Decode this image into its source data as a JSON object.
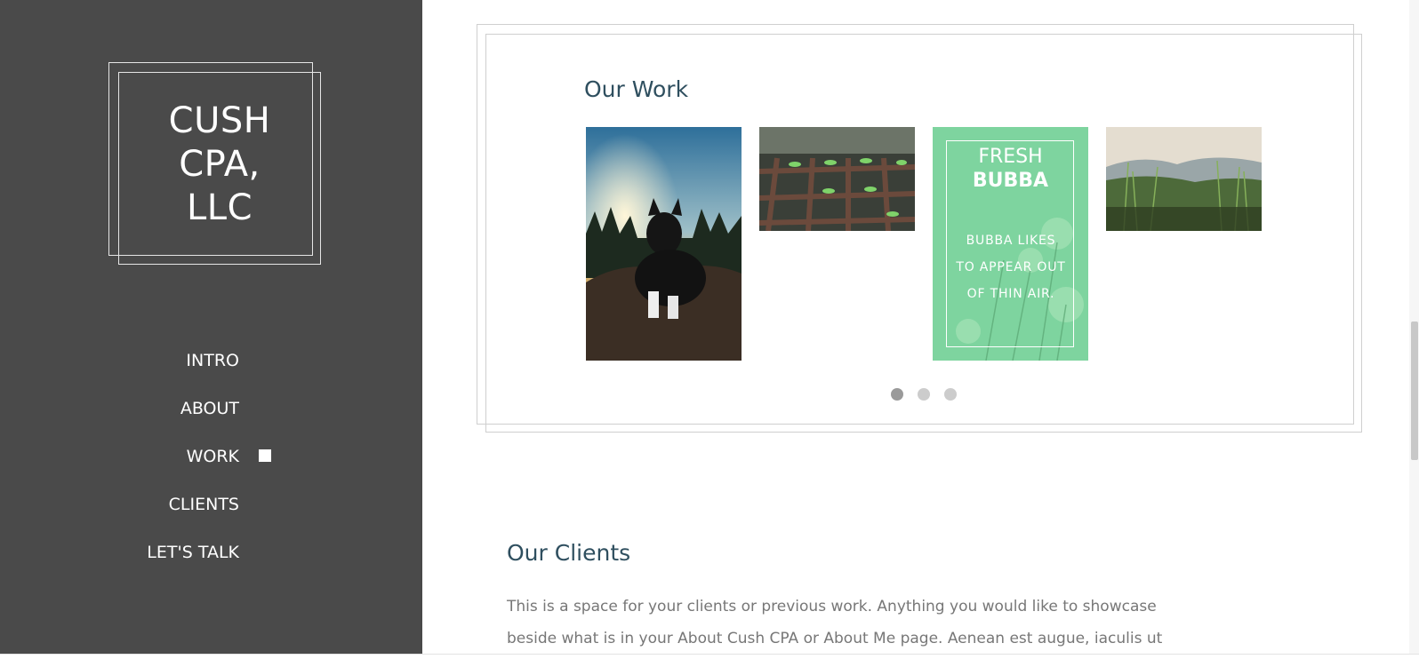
{
  "sidebar": {
    "logo": {
      "line1": "CUSH",
      "line2": "CPA,",
      "line3": "LLC"
    },
    "nav": [
      {
        "label": "INTRO"
      },
      {
        "label": "ABOUT"
      },
      {
        "label": "WORK",
        "active": true
      },
      {
        "label": "CLIENTS"
      },
      {
        "label": "LET'S TALK"
      }
    ],
    "colors": {
      "background": "#4a4a4a",
      "text": "#ffffff"
    }
  },
  "work": {
    "title": "Our Work",
    "items": [
      {
        "image": "dog-on-rock-photo"
      },
      {
        "image": "seedlings-tray-photo"
      },
      {
        "image": "flower-card",
        "heading_line1": "FRESH",
        "heading_line2": "BUBBA",
        "body": "BUBBA LIKES TO APPEAR OUT OF THIN AIR."
      },
      {
        "image": "grass-field-photo"
      }
    ],
    "carousel": {
      "pages": 3,
      "current": 1
    }
  },
  "clients": {
    "title": "Our Clients",
    "text": "This is a space for your clients or previous work. Anything you would like to showcase beside what is in your About Cush CPA or About Me page. Aenean est augue, iaculis ut"
  },
  "colors": {
    "heading": "#2f4f5f",
    "body_text": "#777777",
    "card_green": "#7ed49f"
  }
}
